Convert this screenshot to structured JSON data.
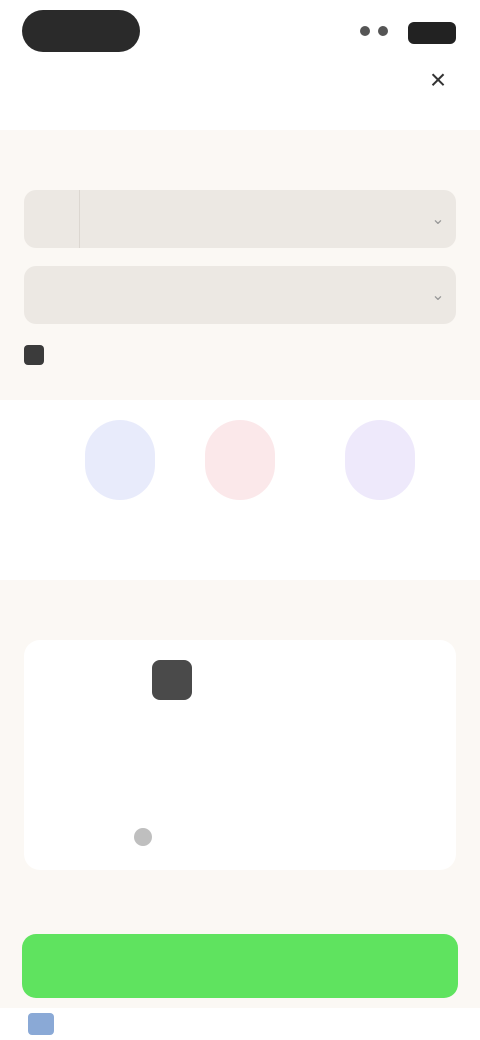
{
  "status_bar": {
    "time": ""
  },
  "header": {
    "close_icon": "close-icon",
    "close_label": "×"
  },
  "form": {
    "section_label": "",
    "field_1": {
      "icon": "",
      "value": "",
      "chevron": "⌄"
    },
    "field_2": {
      "value": "",
      "chevron": "⌄"
    },
    "note": ""
  },
  "options": [
    {
      "label": "",
      "icon": ""
    },
    {
      "label": "",
      "icon": ""
    },
    {
      "label": "",
      "icon": ""
    }
  ],
  "card": {
    "header_left": "",
    "header_right": "",
    "brand_name": "",
    "brand_sub": "",
    "title": "",
    "desc": "",
    "link": ""
  },
  "footer": {
    "note": "",
    "primary_button": "",
    "bottom_left": "",
    "bottom_right": ""
  },
  "colors": {
    "primary_green": "#5fe35f",
    "background": "#fbf8f4",
    "field_bg": "#ece8e3"
  }
}
